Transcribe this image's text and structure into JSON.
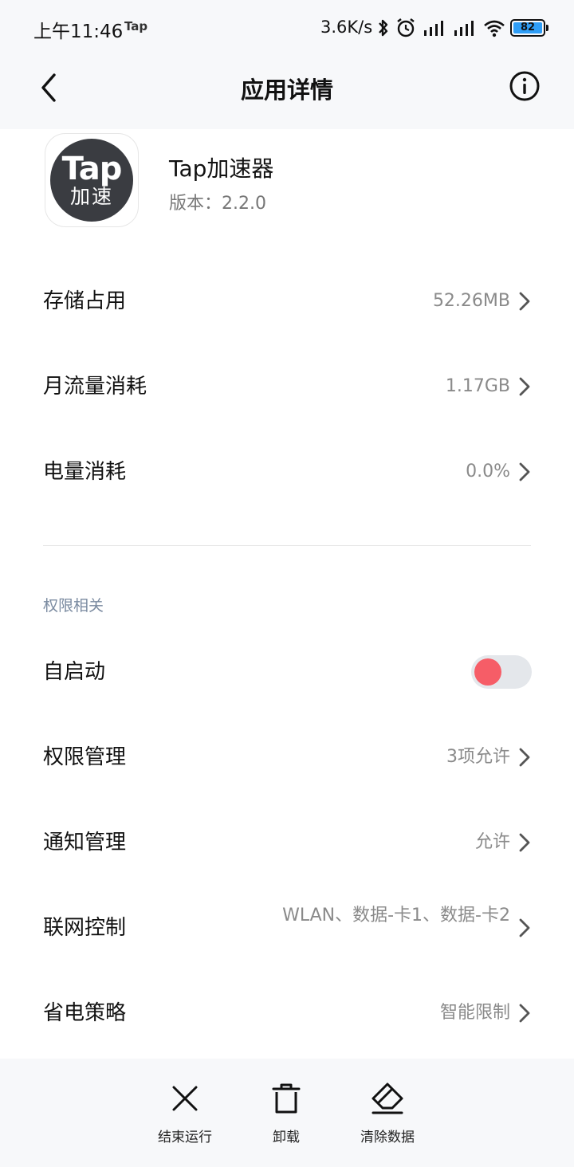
{
  "status_bar": {
    "time": "上午11:46",
    "notif_app": "Tap",
    "net_speed": "3.6K/s",
    "battery": "82",
    "accent_battery": "#2f9ef6"
  },
  "header": {
    "title": "应用详情",
    "back_icon": "chevron-left-icon",
    "info_icon": "info-icon"
  },
  "app": {
    "icon_line1": "Tap",
    "icon_line2": "加速",
    "name": "Tap加速器",
    "version": "版本：2.2.0"
  },
  "usage": [
    {
      "label": "存储占用",
      "value": "52.26MB"
    },
    {
      "label": "月流量消耗",
      "value": "1.17GB"
    },
    {
      "label": "电量消耗",
      "value": "0.0%"
    }
  ],
  "permissions": {
    "section_title": "权限相关",
    "autostart": {
      "label": "自启动",
      "enabled": true,
      "toggle_color": "#f65d67"
    },
    "items": [
      {
        "label": "权限管理",
        "value": "3项允许"
      },
      {
        "label": "通知管理",
        "value": "允许"
      },
      {
        "label": "联网控制",
        "value": "WLAN、数据-卡1、数据-卡2"
      },
      {
        "label": "省电策略",
        "value": "智能限制"
      }
    ]
  },
  "actions": [
    {
      "label": "结束运行",
      "icon": "close-icon"
    },
    {
      "label": "卸载",
      "icon": "trash-icon"
    },
    {
      "label": "清除数据",
      "icon": "eraser-icon"
    }
  ]
}
